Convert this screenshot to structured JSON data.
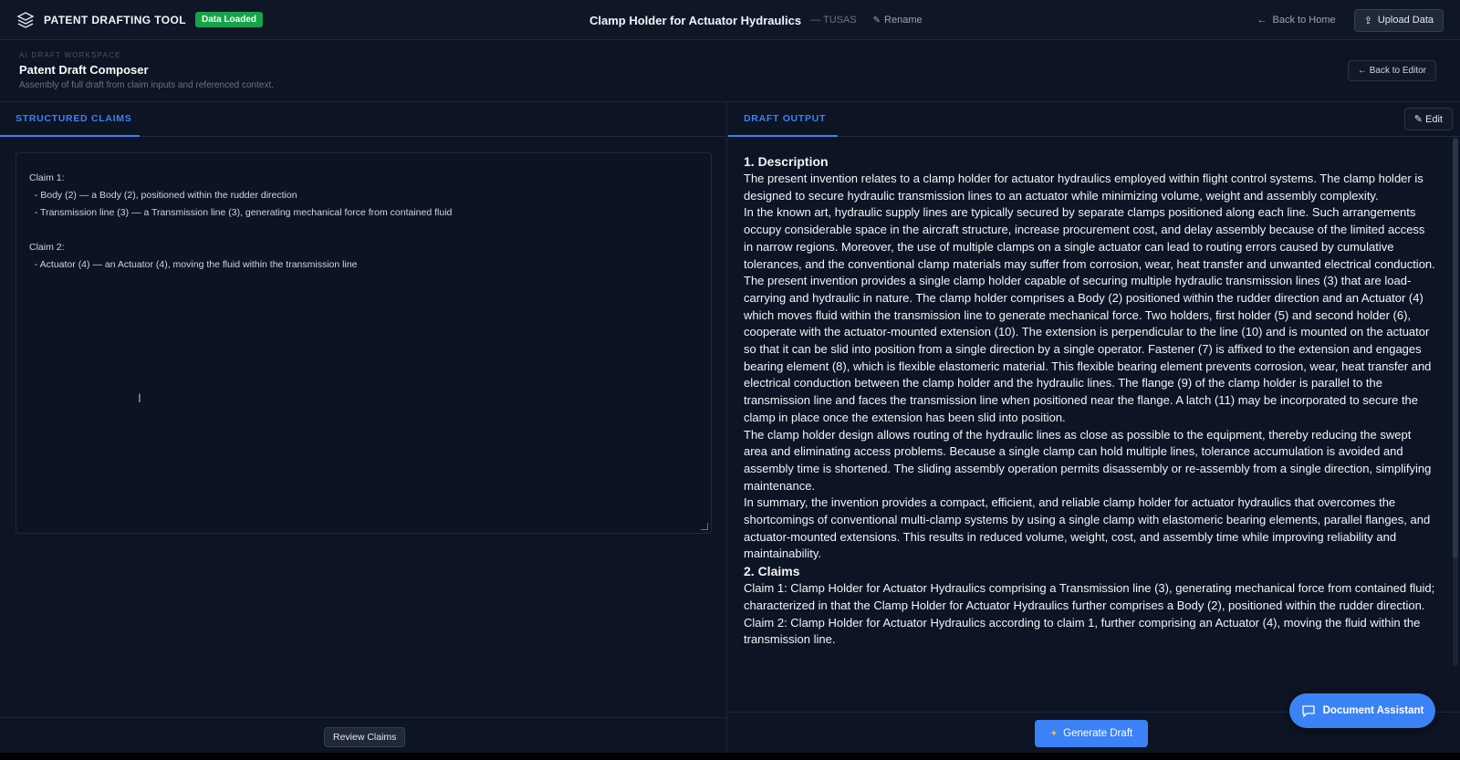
{
  "topbar": {
    "brand": "PATENT DRAFTING TOOL",
    "status_badge": "Data Loaded",
    "project_title": "Clamp Holder for Actuator Hydraulics",
    "project_sub": "— TUSAS",
    "rename": "Rename",
    "back_home": "Back to Home",
    "upload": "Upload Data"
  },
  "header": {
    "kicker": "AI DRAFT WORKSPACE",
    "title": "Patent Draft Composer",
    "description": "Assembly of full draft from claim inputs and referenced context.",
    "back_editor": "← Back to Editor"
  },
  "left": {
    "tab": "STRUCTURED CLAIMS",
    "claims_lines": [
      "Claim 1:",
      "  - Body (2) — a Body (2), positioned within the rudder direction",
      "  - Transmission line (3) — a Transmission line (3), generating mechanical force from contained fluid",
      "",
      "Claim 2:",
      "  - Actuator (4) — an Actuator (4), moving the fluid within the transmission line"
    ],
    "review_button": "Review Claims"
  },
  "right": {
    "tab": "DRAFT OUTPUT",
    "edit": "Edit",
    "description_heading": "1. Description",
    "paragraphs": [
      "The present invention relates to a clamp holder for actuator hydraulics employed within flight control systems. The clamp holder is designed to secure hydraulic transmission lines to an actuator while minimizing volume, weight and assembly complexity.",
      "In the known art, hydraulic supply lines are typically secured by separate clamps positioned along each line. Such arrangements occupy considerable space in the aircraft structure, increase procurement cost, and delay assembly because of the limited access in narrow regions. Moreover, the use of multiple clamps on a single actuator can lead to routing errors caused by cumulative tolerances, and the conventional clamp materials may suffer from corrosion, wear, heat transfer and unwanted electrical conduction.",
      "The present invention provides a single clamp holder capable of securing multiple hydraulic transmission lines (3) that are load-carrying and hydraulic in nature. The clamp holder comprises a Body (2) positioned within the rudder direction and an Actuator (4) which moves fluid within the transmission line to generate mechanical force. Two holders, first holder (5) and second holder (6), cooperate with the actuator-mounted extension (10). The extension is perpendicular to the line (10) and is mounted on the actuator so that it can be slid into position from a single direction by a single operator. Fastener (7) is affixed to the extension and engages bearing element (8), which is flexible elastomeric material. This flexible bearing element prevents corrosion, wear, heat transfer and electrical conduction between the clamp holder and the hydraulic lines. The flange (9) of the clamp holder is parallel to the transmission line and faces the transmission line when positioned near the flange. A latch (11) may be incorporated to secure the clamp in place once the extension has been slid into position.",
      "The clamp holder design allows routing of the hydraulic lines as close as possible to the equipment, thereby reducing the swept area and eliminating access problems. Because a single clamp can hold multiple lines, tolerance accumulation is avoided and assembly time is shortened. The sliding assembly operation permits disassembly or re-assembly from a single direction, simplifying maintenance.",
      "In summary, the invention provides a compact, efficient, and reliable clamp holder for actuator hydraulics that overcomes the shortcomings of conventional multi-clamp systems by using a single clamp with elastomeric bearing elements, parallel flanges, and actuator-mounted extensions. This results in reduced volume, weight, cost, and assembly time while improving reliability and maintainability."
    ],
    "claims_heading": "2. Claims",
    "claims": [
      "Claim 1: Clamp Holder for Actuator Hydraulics comprising a Transmission line (3), generating mechanical force from contained fluid; characterized in that the Clamp Holder for Actuator Hydraulics further comprises a Body (2), positioned within the rudder direction.",
      "Claim 2: Clamp Holder for Actuator Hydraulics according to claim 1, further comprising an Actuator (4), moving the fluid within the transmission line."
    ],
    "generate_button": "Generate Draft"
  },
  "assistant": {
    "label": "Document Assistant"
  },
  "colors": {
    "accent": "#3b82f6",
    "success": "#16a34a",
    "background": "#0d1423"
  }
}
